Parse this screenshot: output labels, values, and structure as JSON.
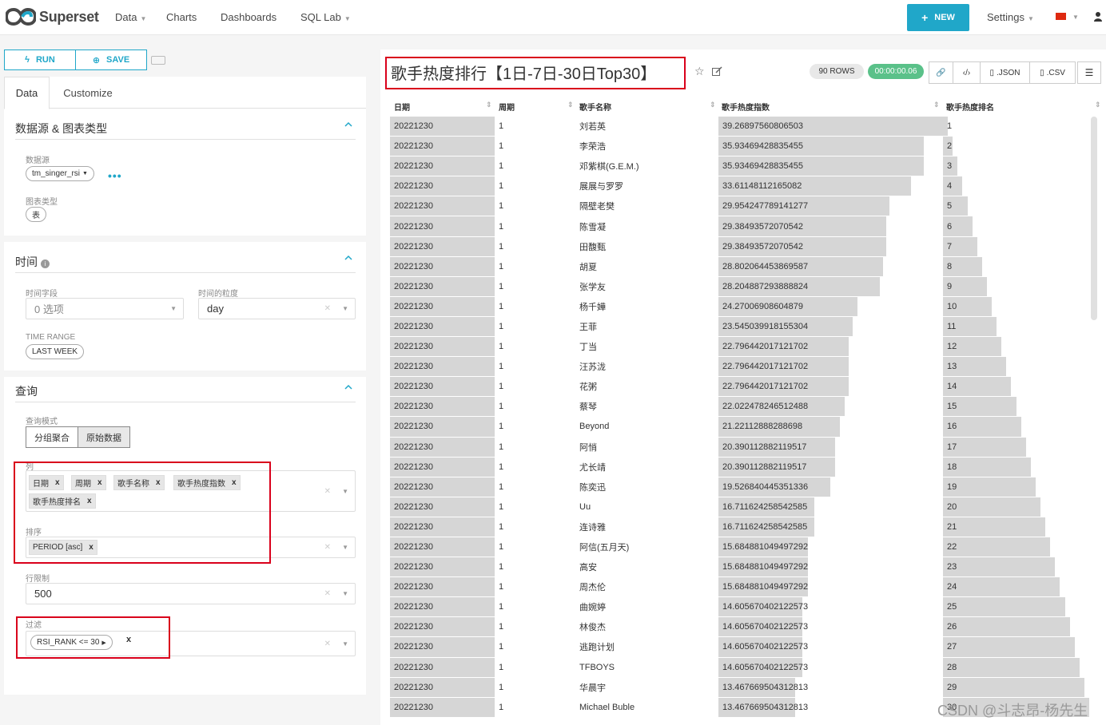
{
  "navbar": {
    "logo": "Superset",
    "items": [
      "Data",
      "Charts",
      "Dashboards",
      "SQL Lab"
    ],
    "new_label": "NEW",
    "settings_label": "Settings",
    "brand_color": "#20a7c9"
  },
  "actions": {
    "run_label": "RUN",
    "save_label": "SAVE"
  },
  "tabs": [
    "Data",
    "Customize"
  ],
  "sections": {
    "datasource": {
      "title": "数据源 & 图表类型",
      "datasource_label": "数据源",
      "datasource_value": "tm_singer_rsi",
      "viz_label": "图表类型",
      "viz_value": "表"
    },
    "time": {
      "title": "时间",
      "time_column_label": "时间字段",
      "time_column_value": "0 选项",
      "time_grain_label": "时间的粒度",
      "time_grain_value": "day",
      "time_range_label": "TIME RANGE",
      "time_range_value": "LAST WEEK"
    },
    "query": {
      "title": "查询",
      "mode_label": "查询模式",
      "mode_options": [
        "分组聚合",
        "原始数据"
      ],
      "columns_label": "列",
      "columns": [
        "日期",
        "周期",
        "歌手名称",
        "歌手热度指数",
        "歌手热度排名"
      ],
      "ordering_label": "排序",
      "ordering": [
        "PERIOD [asc]"
      ],
      "row_limit_label": "行限制",
      "row_limit_value": "500",
      "filters_label": "过滤",
      "filters": [
        "RSI_RANK <= 30"
      ]
    }
  },
  "chart": {
    "title": "歌手热度排行【1日-7日-30日Top30】",
    "rows_badge": "90 ROWS",
    "time_badge": "00:00:00.06",
    "toolbar": [
      ".JSON",
      ".CSV"
    ],
    "columns": [
      "日期",
      "周期",
      "歌手名称",
      "歌手热度指数",
      "歌手热度排名"
    ],
    "rows": [
      [
        "20221230",
        "1",
        "刘若英",
        "39.26897560806503",
        "1"
      ],
      [
        "20221230",
        "1",
        "李荣浩",
        "35.93469428835455",
        "2"
      ],
      [
        "20221230",
        "1",
        "邓紫棋(G.E.M.)",
        "35.93469428835455",
        "3"
      ],
      [
        "20221230",
        "1",
        "展展与罗罗",
        "33.61148112165082",
        "4"
      ],
      [
        "20221230",
        "1",
        "隔壁老樊",
        "29.954247789141277",
        "5"
      ],
      [
        "20221230",
        "1",
        "陈雪凝",
        "29.38493572070542",
        "6"
      ],
      [
        "20221230",
        "1",
        "田馥甄",
        "29.38493572070542",
        "7"
      ],
      [
        "20221230",
        "1",
        "胡夏",
        "28.802064453869587",
        "8"
      ],
      [
        "20221230",
        "1",
        "张学友",
        "28.204887293888824",
        "9"
      ],
      [
        "20221230",
        "1",
        "杨千嬅",
        "24.27006908604879",
        "10"
      ],
      [
        "20221230",
        "1",
        "王菲",
        "23.545039918155304",
        "11"
      ],
      [
        "20221230",
        "1",
        "丁当",
        "22.796442017121702",
        "12"
      ],
      [
        "20221230",
        "1",
        "汪苏泷",
        "22.796442017121702",
        "13"
      ],
      [
        "20221230",
        "1",
        "花粥",
        "22.796442017121702",
        "14"
      ],
      [
        "20221230",
        "1",
        "蔡琴",
        "22.022478246512488",
        "15"
      ],
      [
        "20221230",
        "1",
        "Beyond",
        "21.22112888288698",
        "16"
      ],
      [
        "20221230",
        "1",
        "阿悄",
        "20.390112882119517",
        "17"
      ],
      [
        "20221230",
        "1",
        "尤长靖",
        "20.390112882119517",
        "18"
      ],
      [
        "20221230",
        "1",
        "陈奕迅",
        "19.526840445351336",
        "19"
      ],
      [
        "20221230",
        "1",
        "Uu",
        "16.711624258542585",
        "20"
      ],
      [
        "20221230",
        "1",
        "连诗雅",
        "16.711624258542585",
        "21"
      ],
      [
        "20221230",
        "1",
        "阿信(五月天)",
        "15.684881049497292",
        "22"
      ],
      [
        "20221230",
        "1",
        "高安",
        "15.684881049497292",
        "23"
      ],
      [
        "20221230",
        "1",
        "周杰伦",
        "15.684881049497292",
        "24"
      ],
      [
        "20221230",
        "1",
        "曲婉婷",
        "14.605670402122573",
        "25"
      ],
      [
        "20221230",
        "1",
        "林俊杰",
        "14.605670402122573",
        "26"
      ],
      [
        "20221230",
        "1",
        "逃跑计划",
        "14.605670402122573",
        "27"
      ],
      [
        "20221230",
        "1",
        "TFBOYS",
        "14.605670402122573",
        "28"
      ],
      [
        "20221230",
        "1",
        "华晨宇",
        "13.467669504312813",
        "29"
      ],
      [
        "20221230",
        "1",
        "Michael Buble",
        "13.467669504312813",
        "30"
      ]
    ]
  },
  "watermark": "CSDN @斗志昂-杨先生"
}
